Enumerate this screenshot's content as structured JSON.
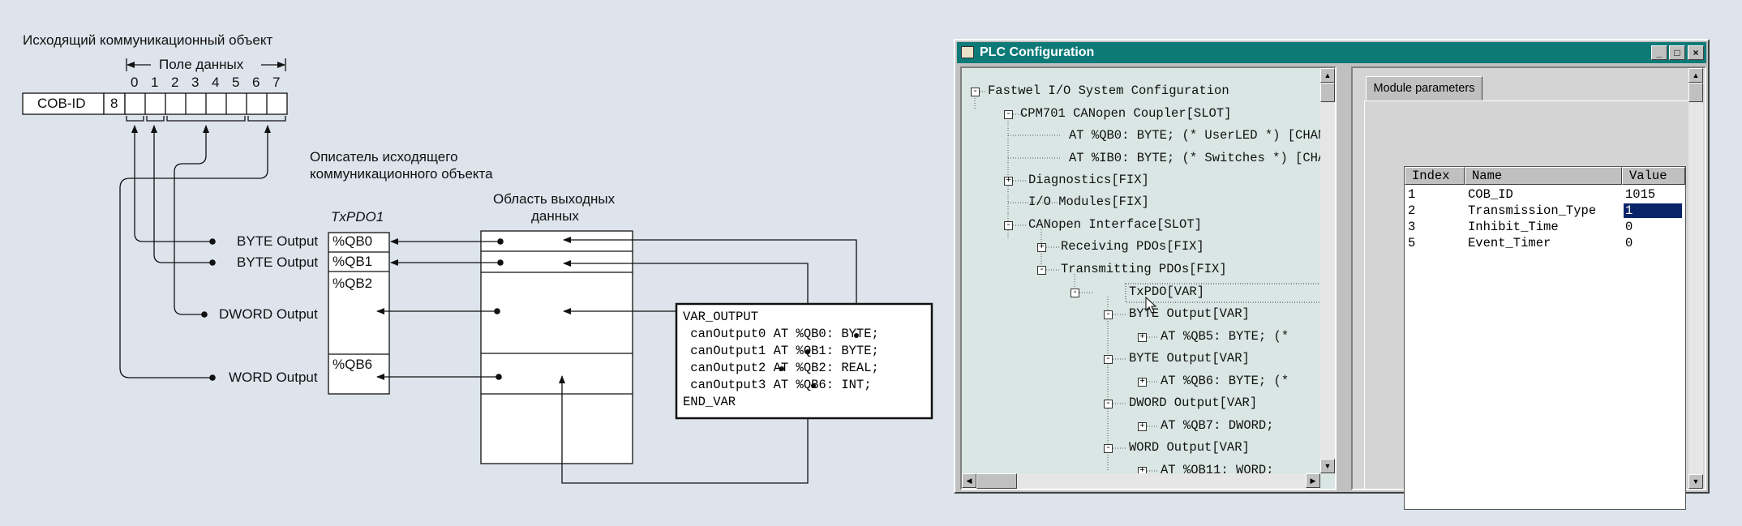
{
  "diagram": {
    "title": "Исходящий коммуникационный объект",
    "data_field_label": "Поле данных",
    "bit_numbers": [
      "0",
      "1",
      "2",
      "3",
      "4",
      "5",
      "6",
      "7"
    ],
    "cob_id_label": "COB-ID",
    "dlc_value": "8",
    "descriptor_label_line1": "Описатель исходящего",
    "descriptor_label_line2": "коммуникационного объекта",
    "txpdo_label": "TxPDO1",
    "output_area_line1": "Область выходных",
    "output_area_line2": "данных",
    "outputs": [
      "BYTE Output",
      "BYTE Output",
      "DWORD Output",
      "WORD Output"
    ],
    "qb_cells": [
      "%QB0",
      "%QB1",
      "%QB2",
      "%QB6"
    ],
    "code_lines": [
      "VAR_OUTPUT",
      " canOutput0 AT %QB0: BYTE;",
      " canOutput1 AT %QB1: BYTE;",
      " canOutput2 AT %QB2: REAL;",
      " canOutput3 AT %QB6: INT;",
      "END_VAR"
    ]
  },
  "window": {
    "title": "PLC Configuration",
    "tree": [
      {
        "text": "Fastwel I/O System Configuration",
        "box": "minus"
      },
      {
        "text": "CPM701 CANopen Coupler[SLOT]",
        "box": "minus"
      },
      {
        "text": "AT %QB0: BYTE; (* UserLED *) [CHAN",
        "box": ""
      },
      {
        "text": "AT %IB0: BYTE; (* Switches *) [CHA",
        "box": ""
      },
      {
        "text": "Diagnostics[FIX]",
        "box": "plus"
      },
      {
        "text": "I/O Modules[FIX]",
        "box": ""
      },
      {
        "text": "CANopen Interface[SLOT]",
        "box": "minus"
      },
      {
        "text": "Receiving PDOs[FIX]",
        "box": "plus"
      },
      {
        "text": "Transmitting PDOs[FIX]",
        "box": "minus"
      },
      {
        "text": "TxPDO[VAR]",
        "box": "minus"
      },
      {
        "text": "BYTE Output[VAR]",
        "box": "minus"
      },
      {
        "text": "AT %QB5: BYTE; (*",
        "box": "plus"
      },
      {
        "text": "BYTE Output[VAR]",
        "box": "minus"
      },
      {
        "text": "AT %QB6: BYTE; (*",
        "box": "plus"
      },
      {
        "text": "DWORD Output[VAR]",
        "box": "minus"
      },
      {
        "text": "AT %QB7: DWORD;",
        "box": "plus"
      },
      {
        "text": "WORD Output[VAR]",
        "box": "minus"
      },
      {
        "text": "AT %QB11: WORD;",
        "box": "plus"
      }
    ],
    "tab_label": "Module parameters",
    "table_headers": [
      "Index",
      "Name",
      "Value"
    ],
    "table_rows": [
      [
        "1",
        "COB_ID",
        "1015"
      ],
      [
        "2",
        "Transmission_Type",
        "1"
      ],
      [
        "3",
        "Inhibit_Time",
        "0"
      ],
      [
        "5",
        "Event_Timer",
        "0"
      ]
    ]
  }
}
